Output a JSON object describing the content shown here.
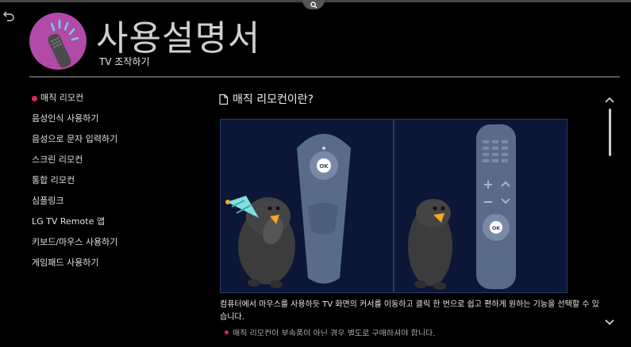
{
  "header": {
    "title": "사용설명서",
    "subtitle": "TV 조작하기"
  },
  "nav": {
    "items": [
      {
        "label": "매직 리모컨",
        "active": true
      },
      {
        "label": "음성인식 사용하기",
        "active": false
      },
      {
        "label": "음성으로 문자 입력하기",
        "active": false
      },
      {
        "label": "스크린 리모컨",
        "active": false
      },
      {
        "label": "통합 리모컨",
        "active": false
      },
      {
        "label": "심플링크",
        "active": false
      },
      {
        "label": "LG TV Remote 앱",
        "active": false
      },
      {
        "label": "키보드/마우스 사용하기",
        "active": false
      },
      {
        "label": "게임패드 사용하기",
        "active": false
      }
    ]
  },
  "content": {
    "section_title": "매직 리모컨이란?",
    "body": "컴퓨터에서 마우스를 사용하듯 TV 화면의 커서를 이동하고 클릭 한 번으로 쉽고 편하게 원하는 기능을 선택할 수 있습니다.",
    "note": "매직 리모컨이 부속품이 아닌 경우 별도로 구매하셔야 합니다.",
    "ok_label": "OK"
  },
  "colors": {
    "accent": "#e8265a",
    "logo_bg": "#b24aa8",
    "illustration_bg": "#0c1636"
  },
  "icons": {
    "search": "search-icon",
    "back": "back-arrow-icon",
    "document": "document-icon",
    "scroll_up": "chevron-up-icon",
    "scroll_down": "chevron-down-icon"
  }
}
